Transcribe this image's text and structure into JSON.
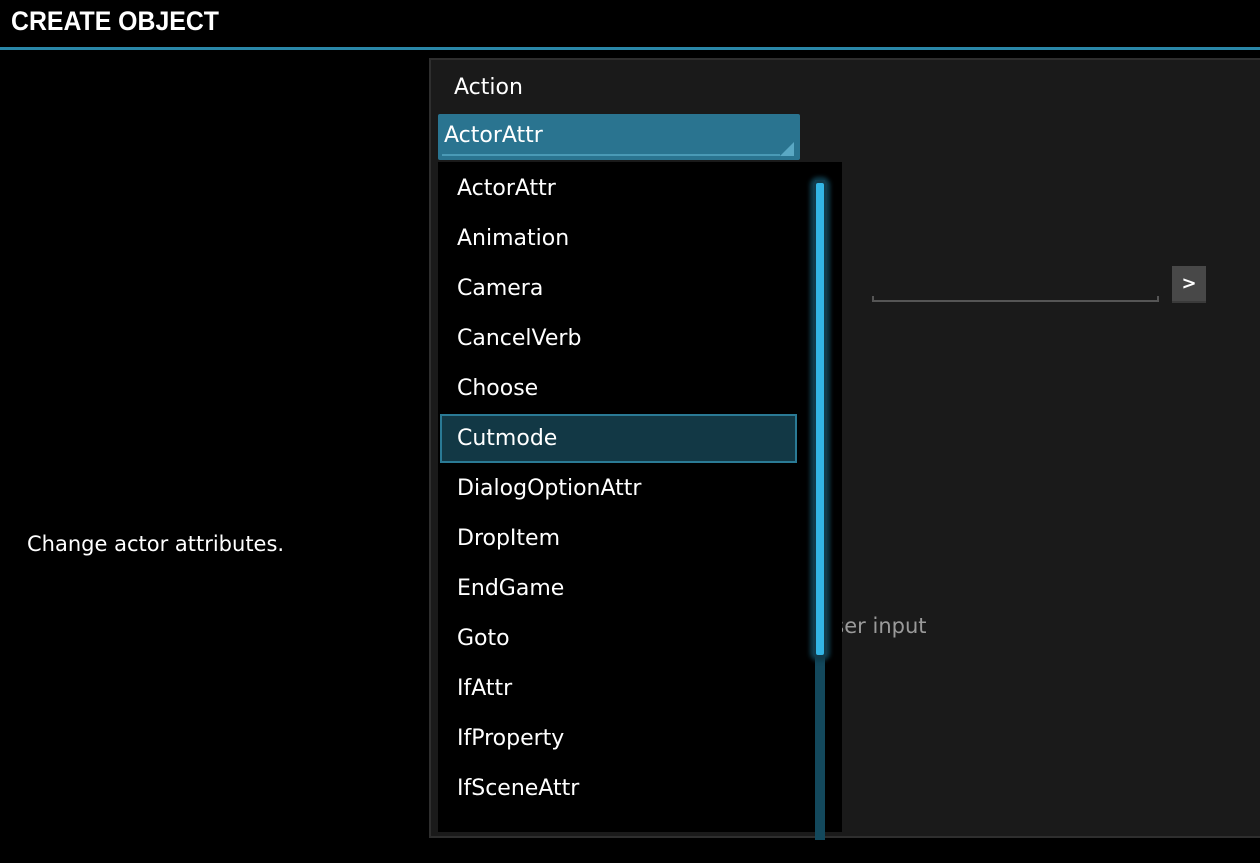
{
  "header": {
    "title": "CREATE OBJECT"
  },
  "description": "Change actor attributes.",
  "form": {
    "action_label": "Action",
    "action_value": "ActorAttr",
    "text_value": "",
    "go_button_label": ">",
    "hint_text": "user input"
  },
  "dropdown": {
    "items": [
      "ActorAttr",
      "Animation",
      "Camera",
      "CancelVerb",
      "Choose",
      "Cutmode",
      "DialogOptionAttr",
      "DropItem",
      "EndGame",
      "Goto",
      "IfAttr",
      "IfProperty",
      "IfSceneAttr",
      ""
    ],
    "highlighted": "Cutmode"
  },
  "colors": {
    "accent": "#33b5e5",
    "select_bg": "#2a7490",
    "highlight_bg": "#123845",
    "panel_bg": "#1a1a1a"
  }
}
